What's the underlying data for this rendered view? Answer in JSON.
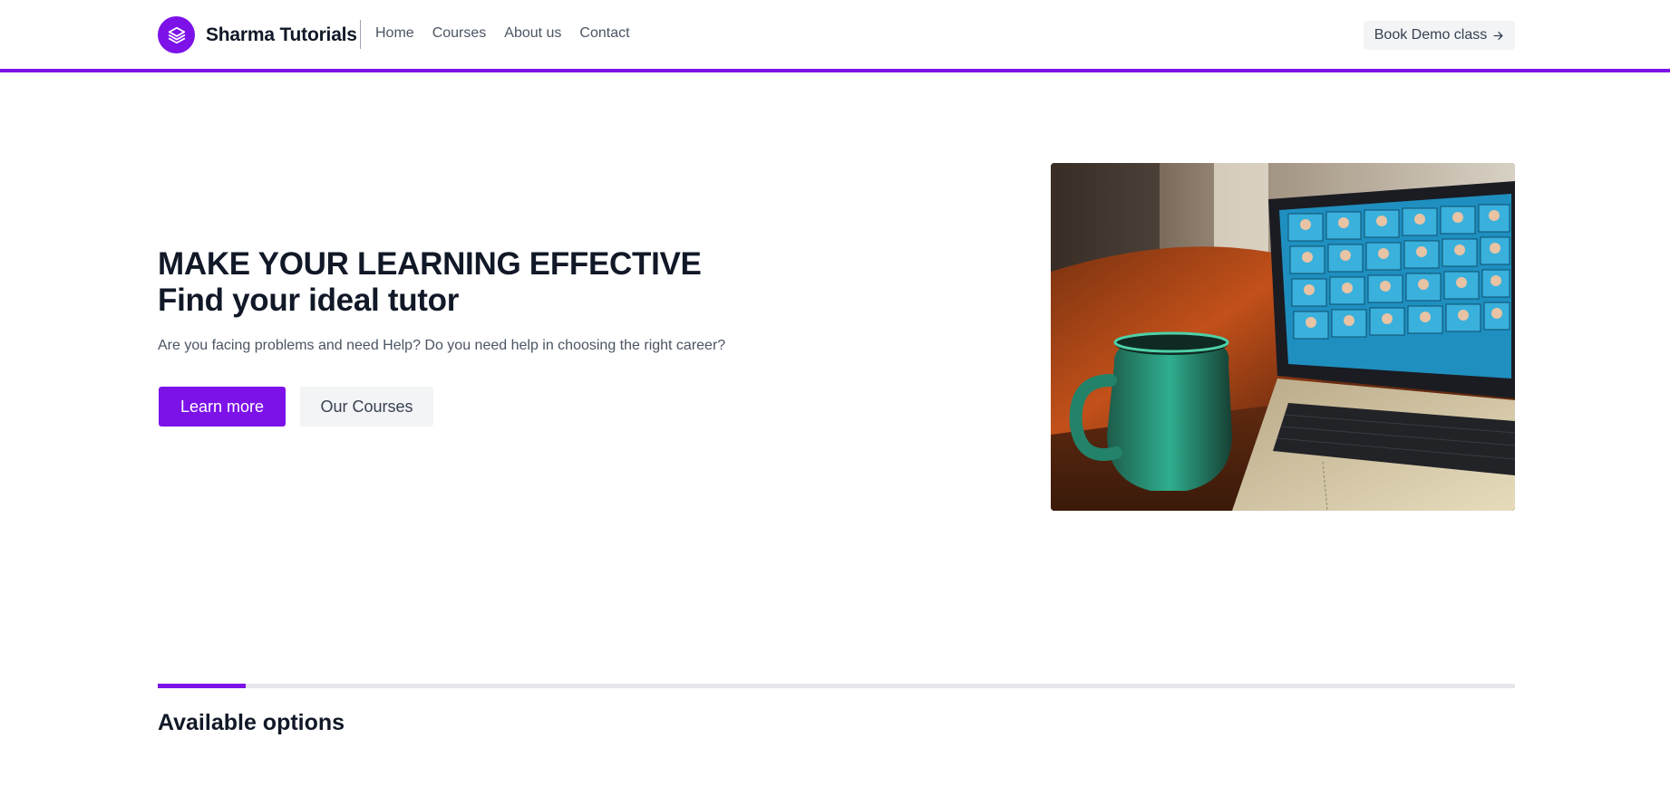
{
  "header": {
    "brand_name": "Sharma Tutorials",
    "logo_icon": "layers-icon",
    "nav": [
      {
        "label": "Home"
      },
      {
        "label": "Courses"
      },
      {
        "label": "About us"
      },
      {
        "label": "Contact"
      }
    ],
    "cta_label": "Book Demo class",
    "cta_icon": "arrow-right-icon"
  },
  "hero": {
    "title_line1": "MAKE YOUR LEARNING EFFECTIVE",
    "title_line2": "Find your ideal tutor",
    "subtitle": "Are you facing problems and need Help? Do you need help in choosing the right career?",
    "primary_button": "Learn more",
    "secondary_button": "Our Courses",
    "image_alt": "photo of a green mug next to a laptop showing a video call grid"
  },
  "options": {
    "title": "Available options",
    "progress_fraction": 0.065
  },
  "colors": {
    "accent": "#7c12e8",
    "text_dark": "#111827",
    "text_muted": "#4b5563",
    "button_gray": "#f3f4f6"
  }
}
